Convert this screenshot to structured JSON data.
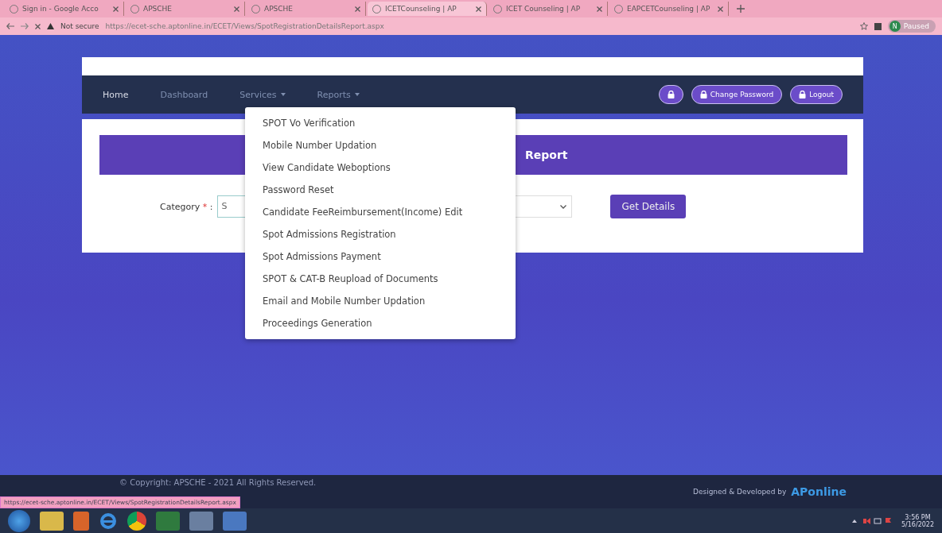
{
  "browser": {
    "tabs": [
      {
        "title": "Sign in - Google Acco",
        "selected": false
      },
      {
        "title": "APSCHE",
        "selected": false
      },
      {
        "title": "APSCHE",
        "selected": false
      },
      {
        "title": "ICETCounseling | AP",
        "selected": true
      },
      {
        "title": "ICET Counseling | AP",
        "selected": false
      },
      {
        "title": "EAPCETCounseling | AP",
        "selected": false
      }
    ],
    "security": "Not secure",
    "url": "https://ecet-sche.aptonline.in/ECET/Views/SpotRegistrationDetailsReport.aspx",
    "profile_initials": "N",
    "profile_status": "Paused"
  },
  "nav": {
    "items": [
      {
        "label": "Home",
        "has_menu": false,
        "selected": true
      },
      {
        "label": "Dashboard",
        "has_menu": false,
        "selected": false
      },
      {
        "label": "Services",
        "has_menu": true,
        "selected": false
      },
      {
        "label": "Reports",
        "has_menu": true,
        "selected": false
      }
    ],
    "buttons": [
      {
        "kind": "icon"
      },
      {
        "kind": "text",
        "label": "Change Password"
      },
      {
        "kind": "text",
        "label": "Logout"
      }
    ]
  },
  "services_menu": [
    "SPOT Vo Verification",
    "Mobile Number Updation",
    "View Candidate Weboptions",
    "Password Reset",
    "Candidate FeeReimbursement(Income) Edit",
    "Spot Admissions Registration",
    "Spot Admissions Payment",
    "SPOT & CAT-B Reupload of Documents",
    "Email and Mobile Number Updation",
    "Proceedings Generation"
  ],
  "report": {
    "title": "Report",
    "category_label": "Category",
    "required_mark": "*",
    "separator": ":",
    "category_value": "S",
    "submit": "Get Details"
  },
  "footer": {
    "copyright": "© Copyright: APSCHE - 2021 All Rights Reserved.",
    "credit": "Designed & Developed by",
    "logo": "APonline"
  },
  "status_url": "https://ecet-sche.aptonline.in/ECET/Views/SpotRegistrationDetailsReport.aspx",
  "taskbar": {
    "time": "3:56 PM",
    "date": "5/16/2022"
  }
}
